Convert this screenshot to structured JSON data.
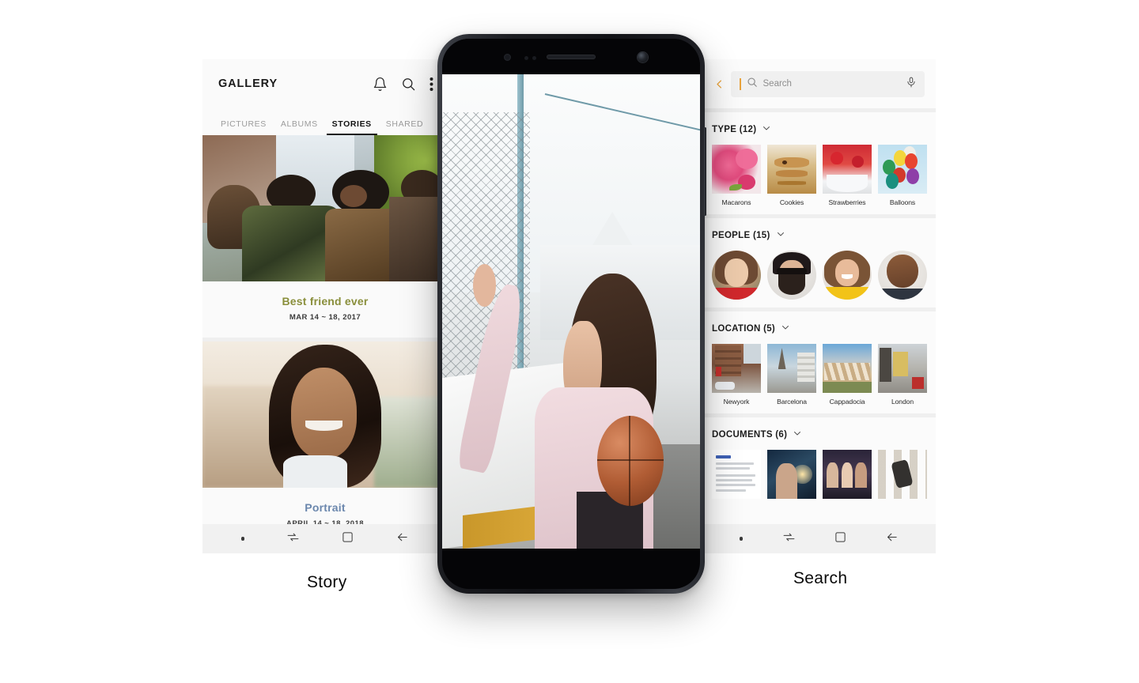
{
  "captions": {
    "left": "Story",
    "right": "Search"
  },
  "left_phone": {
    "app_title": "GALLERY",
    "header_icons": [
      "bell-icon",
      "search-icon",
      "more-vertical-icon"
    ],
    "tabs": [
      {
        "label": "PICTURES",
        "active": false
      },
      {
        "label": "ALBUMS",
        "active": false
      },
      {
        "label": "STORIES",
        "active": true
      },
      {
        "label": "SHARED",
        "active": false
      }
    ],
    "stories": [
      {
        "title": "Best friend ever",
        "date": "MAR 14 ~ 18, 2017",
        "title_color": "#8a8f3c",
        "photo": "group-of-friends-walking"
      },
      {
        "title": "Portrait",
        "date": "APRIL 14 ~ 18, 2018",
        "title_color": "#6b87ad",
        "photo": "woman-selfie-smiling"
      }
    ],
    "navbar": [
      "dot-indicator",
      "recents-icon",
      "home-icon",
      "back-icon"
    ]
  },
  "center_phone": {
    "photo": "woman-holding-basketball-at-fence",
    "bezel": {
      "earpiece": "speaker-grille",
      "front_camera": "front-camera",
      "sensors": "proximity-sensors"
    }
  },
  "right_phone": {
    "search": {
      "back_label": "‹",
      "placeholder": "Search",
      "value": "",
      "mic": "microphone-icon",
      "accent_color": "#e8a33d"
    },
    "sections": [
      {
        "id": "type",
        "title": "TYPE (12)",
        "shape": "square",
        "items": [
          {
            "label": "Macarons",
            "art": "t-macaron"
          },
          {
            "label": "Cookies",
            "art": "t-cookies"
          },
          {
            "label": "Strawberries",
            "art": "t-straw"
          },
          {
            "label": "Balloons",
            "art": "t-balloon"
          }
        ]
      },
      {
        "id": "people",
        "title": "PEOPLE (15)",
        "shape": "circle",
        "items": [
          {
            "label": "",
            "art": "av-1"
          },
          {
            "label": "",
            "art": "av-2"
          },
          {
            "label": "",
            "art": "av-3"
          },
          {
            "label": "",
            "art": "av-4"
          }
        ]
      },
      {
        "id": "location",
        "title": "LOCATION (5)",
        "shape": "square",
        "items": [
          {
            "label": "Newyork",
            "art": "t-ny"
          },
          {
            "label": "Barcelona",
            "art": "t-bcn"
          },
          {
            "label": "Cappadocia",
            "art": "t-cap"
          },
          {
            "label": "London",
            "art": "t-lon"
          }
        ]
      },
      {
        "id": "documents",
        "title": "DOCUMENTS (6)",
        "shape": "square",
        "items": [
          {
            "label": "",
            "art": "t-doc"
          },
          {
            "label": "",
            "art": "t-party"
          },
          {
            "label": "",
            "art": "t-friends2"
          },
          {
            "label": "",
            "art": "t-skate"
          }
        ]
      }
    ],
    "navbar": [
      "dot-indicator",
      "recents-icon",
      "home-icon",
      "back-icon"
    ]
  }
}
